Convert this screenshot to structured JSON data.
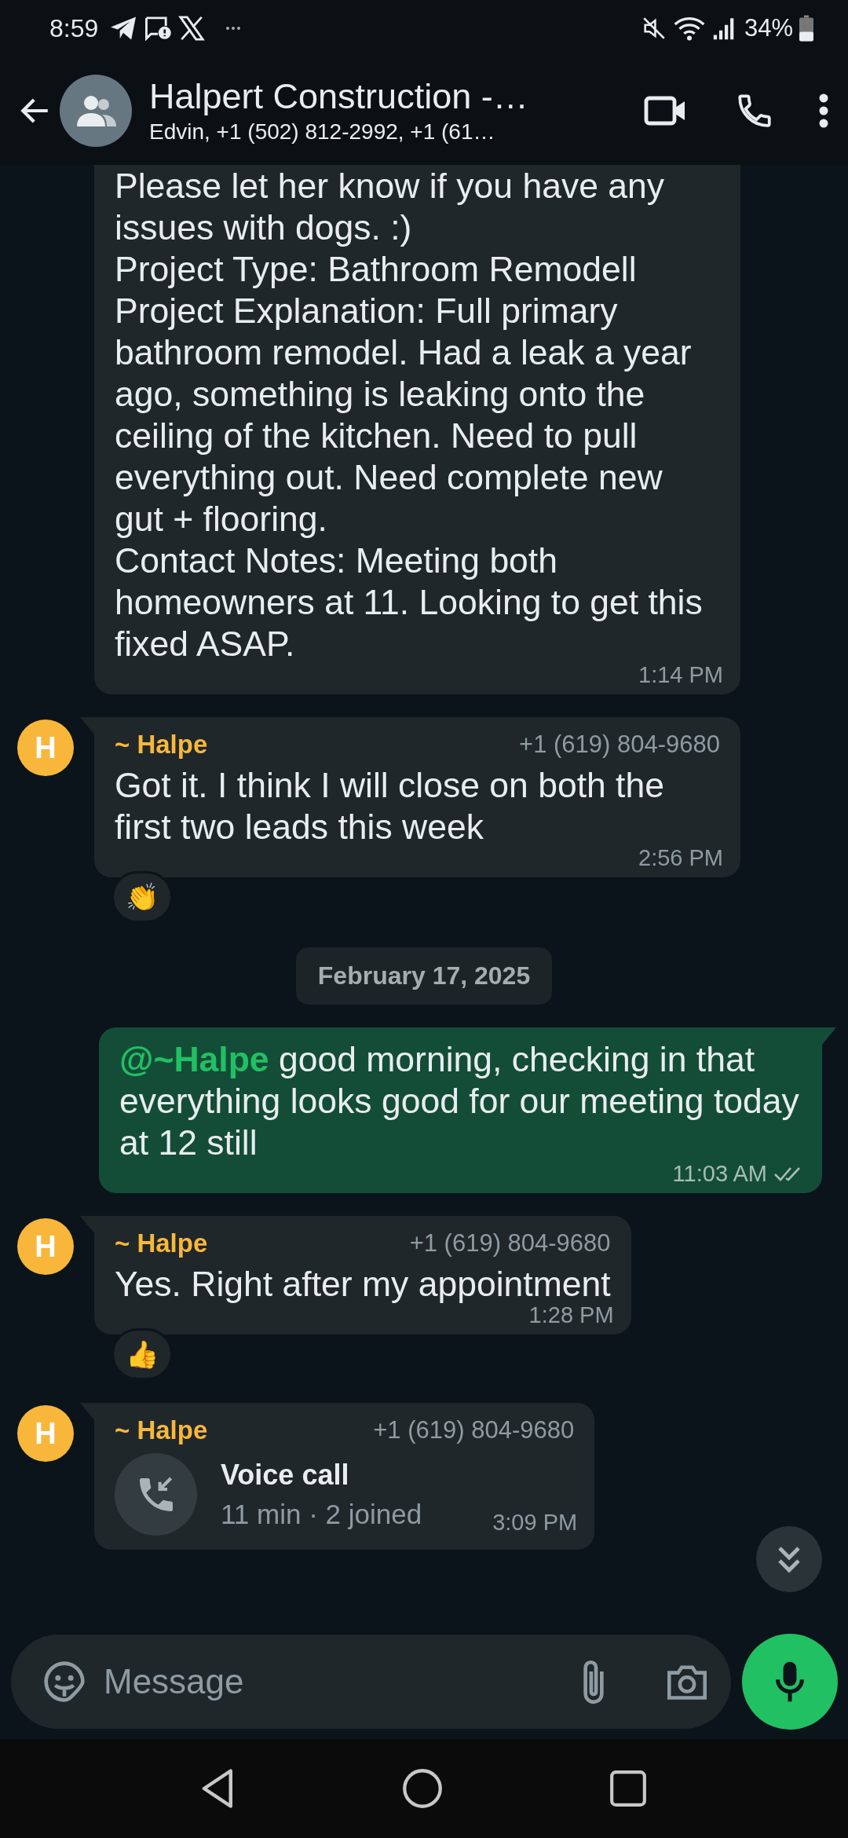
{
  "status_bar": {
    "time": "8:59",
    "battery": "34%"
  },
  "header": {
    "title": "Halpert Construction -…",
    "subtitle": "Edvin, +1 (502) 812-2992, +1 (61…"
  },
  "messages": [
    {
      "kind": "text",
      "outgoing": false,
      "tail": false,
      "text": "Please let her know if you have any issues with dogs. :)\nProject Type: Bathroom Remodell\nProject Explanation: Full primary bathroom remodel. Had a leak a year ago, something is leaking onto the ceiling of the kitchen. Need to pull everything out. Need complete new gut + flooring.\nContact Notes: Meeting both homeowners at 11. Looking to get this fixed ASAP.",
      "time": "1:14 PM"
    },
    {
      "kind": "text",
      "outgoing": false,
      "tail": true,
      "avatar": "H",
      "sender": "~ Halpe",
      "phone": "+1 (619) 804-9680",
      "text": "Got it. I think I will close on both the first two leads this week",
      "time": "2:56 PM",
      "reaction": "👏"
    },
    {
      "kind": "date",
      "text": "February 17, 2025"
    },
    {
      "kind": "text",
      "outgoing": true,
      "tail": true,
      "text": "**@~Halpe** good morning, checking in that everything looks good for our meeting today at 12 still",
      "time": "11:03 AM",
      "read": false
    },
    {
      "kind": "text",
      "outgoing": false,
      "tail": true,
      "avatar": "H",
      "sender": "~ Halpe",
      "phone": "+1 (619) 804-9680",
      "text": "Yes. Right after my appointment",
      "time": "1:28 PM",
      "reaction": "👍"
    },
    {
      "kind": "call",
      "outgoing": false,
      "tail": true,
      "avatar": "H",
      "sender": "~ Halpe",
      "phone": "+1 (619) 804-9680",
      "title": "Voice call",
      "detail": "11 min · 2 joined",
      "time": "3:09 PM"
    }
  ],
  "composer": {
    "placeholder": "Message"
  }
}
